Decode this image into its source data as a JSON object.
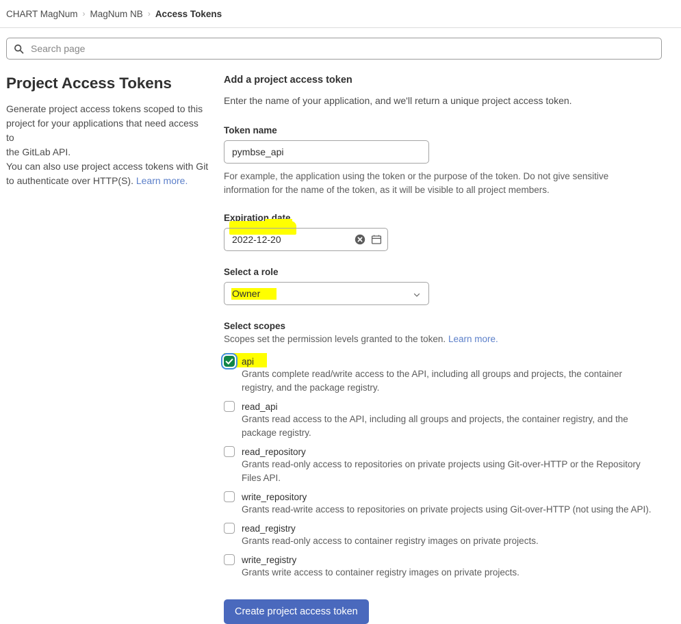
{
  "breadcrumb": {
    "separator": "›",
    "items": [
      {
        "label": "CHART MagNum"
      },
      {
        "label": "MagNum NB"
      },
      {
        "label": "Access Tokens"
      }
    ]
  },
  "search": {
    "placeholder": "Search page",
    "value": "",
    "icon": "search-icon"
  },
  "left": {
    "title": "Project Access Tokens",
    "description": "Generate project access tokens scoped to this project for your applications that need access to the GitLab API.\nYou can also use project access tokens with Git to authenticate over HTTP(S).",
    "description_line1": "Generate project access tokens scoped to this",
    "description_line2": "project for your applications that need access to",
    "description_line3": "the GitLab API.",
    "description_line4": "You can also use project access tokens with Git",
    "description_line5": "to authenticate over HTTP(S).",
    "learn_more": "Learn more."
  },
  "form": {
    "heading": "Add a project access token",
    "subheading": "Enter the name of your application, and we'll return a unique project access token.",
    "token_name": {
      "label": "Token name",
      "value": "pymbse_api",
      "placeholder": "",
      "help": "For example, the application using the token or the purpose of the token. Do not give sensitive information for the name of the token, as it will be visible to all project members."
    },
    "expiration": {
      "label": "Expiration date",
      "value": "2022-12-20",
      "clear_icon": "clear-circle-icon",
      "calendar_icon": "calendar-icon",
      "highlighted": true
    },
    "role": {
      "label": "Select a role",
      "value": "Owner",
      "chevron_icon": "chevron-down-icon",
      "highlighted": true
    },
    "scopes": {
      "title": "Select scopes",
      "subtitle": "Scopes set the permission levels granted to the token.",
      "learn_more": "Learn more.",
      "items": [
        {
          "name": "api",
          "checked": true,
          "highlighted": true,
          "description": "Grants complete read/write access to the API, including all groups and projects, the container registry, and the package registry."
        },
        {
          "name": "read_api",
          "checked": false,
          "highlighted": false,
          "description": "Grants read access to the API, including all groups and projects, the container registry, and the package registry."
        },
        {
          "name": "read_repository",
          "checked": false,
          "highlighted": false,
          "description": "Grants read-only access to repositories on private projects using Git-over-HTTP or the Repository Files API."
        },
        {
          "name": "write_repository",
          "checked": false,
          "highlighted": false,
          "description": "Grants read-write access to repositories on private projects using Git-over-HTTP (not using the API)."
        },
        {
          "name": "read_registry",
          "checked": false,
          "highlighted": false,
          "description": "Grants read-only access to container registry images on private projects."
        },
        {
          "name": "write_registry",
          "checked": false,
          "highlighted": false,
          "description": "Grants write access to container registry images on private projects."
        }
      ]
    },
    "submit_label": "Create project access token"
  },
  "colors": {
    "accent_button": "#4a69bd",
    "link": "#5b7fc9",
    "highlight": "#ffff00",
    "checkbox_checked": "#108548",
    "focus_ring": "#428fdc"
  }
}
